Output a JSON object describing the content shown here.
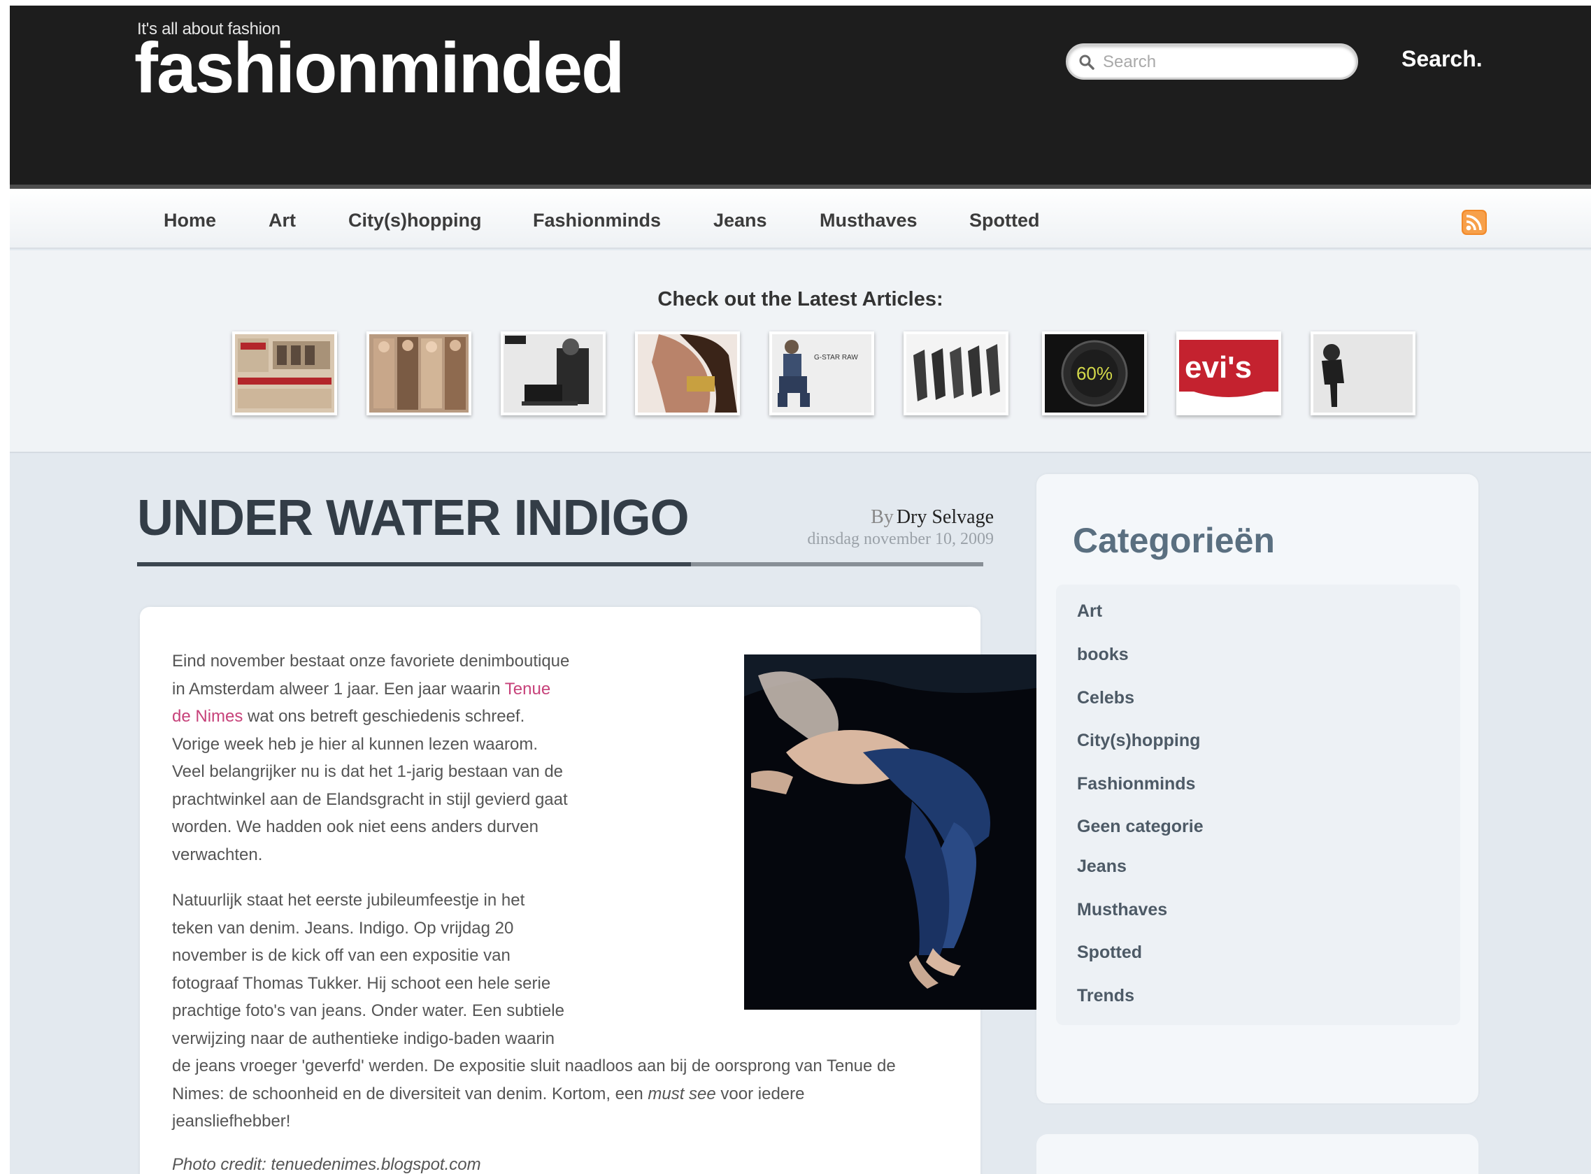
{
  "site": {
    "tagline": "It's all about fashion",
    "logo": "fashionminded"
  },
  "search": {
    "placeholder": "Search",
    "button_label": "Search.",
    "icon": "search-icon"
  },
  "nav": {
    "items": [
      "Home",
      "Art",
      "City(s)hopping",
      "Fashionminds",
      "Jeans",
      "Musthaves",
      "Spotted"
    ],
    "rss_icon": "rss-icon"
  },
  "latest": {
    "heading": "Check out the Latest Articles:",
    "thumb_count": 9
  },
  "post": {
    "title": "UNDER WATER INDIGO",
    "by": "By",
    "author": "Dry Selvage",
    "date": "dinsdag november 10, 2009",
    "p1_a": "Eind november bestaat onze favoriete denimboutique",
    "p1_b": "in Amsterdam alweer 1 jaar. Een jaar waarin",
    "p1_link_1": "Tenue",
    "p1_link_2": "de Nimes",
    "p1_c": "wat ons betreft geschiedenis schreef.",
    "p1_d": "Vorige week heb je hier al kunnen lezen waarom.",
    "p1_e": "Veel belangrijker nu is dat het 1-jarig bestaan van de",
    "p1_f": "prachtwinkel aan de Elandsgracht in stijl gevierd gaat",
    "p1_g": "worden. We hadden ook niet eens anders durven",
    "p1_h": "verwachten.",
    "p2_a": "Natuurlijk staat het eerste jubileumfeestje in het",
    "p2_b": "teken van denim. Jeans. Indigo. Op vrijdag 20",
    "p2_c": "november is de kick off van een expositie van",
    "p2_d": "fotograaf Thomas Tukker. Hij schoot een hele serie",
    "p2_e": "prachtige foto's van jeans. Onder water. Een subtiele",
    "p2_f": "verwijzing naar de authentieke indigo-baden waarin",
    "p2_g": "de jeans vroeger 'geverfd' werden. De expositie sluit naadloos aan bij de oorsprong van Tenue de",
    "p2_h": "Nimes: de schoonheid en de diversiteit van denim. Kortom, een",
    "p2_h_em": "must see",
    "p2_h_end": "voor iedere",
    "p2_i": "jeansliefhebber!",
    "photo_credit": "Photo credit: tenuedenimes.blogspot.com"
  },
  "sidebar": {
    "title": "Categorieën",
    "categories": [
      "Art",
      "books",
      "Celebs",
      "City(s)hopping",
      "Fashionminds",
      "Geen categorie",
      "Jeans",
      "Musthaves",
      "Spotted",
      "Trends"
    ]
  },
  "colors": {
    "header_bg": "#1d1d1d",
    "link": "#c7427a",
    "title": "#333d47",
    "page_bg": "#e3e9ef"
  }
}
